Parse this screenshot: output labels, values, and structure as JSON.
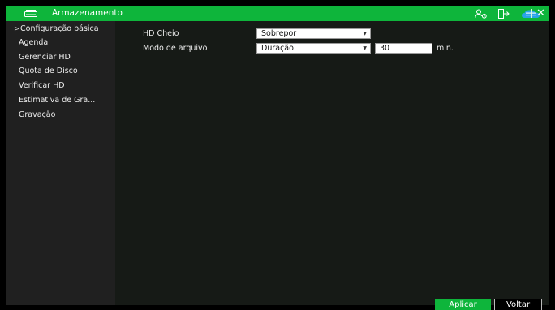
{
  "window": {
    "title": "Armazenamento",
    "close_label": "✕"
  },
  "colors": {
    "accent": "#0eb53b",
    "sidebar_bg": "#202020",
    "main_bg": "#161a16"
  },
  "icons": {
    "hd": "hard-drive-icon",
    "user": "user-settings-icon",
    "logout": "logout-icon",
    "cloud": "cloud-icon",
    "close": "close-icon"
  },
  "sidebar": {
    "items": [
      {
        "label": "Configuração básica",
        "selected": true,
        "chevron": ">"
      },
      {
        "label": "Agenda"
      },
      {
        "label": "Gerenciar HD"
      },
      {
        "label": "Quota de Disco"
      },
      {
        "label": "Verificar HD"
      },
      {
        "label": "Estimativa de Gra..."
      },
      {
        "label": "Gravação"
      }
    ]
  },
  "form": {
    "hd_full": {
      "label": "HD Cheio",
      "value": "Sobrepor"
    },
    "file_mode": {
      "label": "Modo de arquivo",
      "value": "Duração",
      "number": "30",
      "unit": "min."
    }
  },
  "buttons": {
    "apply": "Aplicar",
    "back": "Voltar"
  }
}
